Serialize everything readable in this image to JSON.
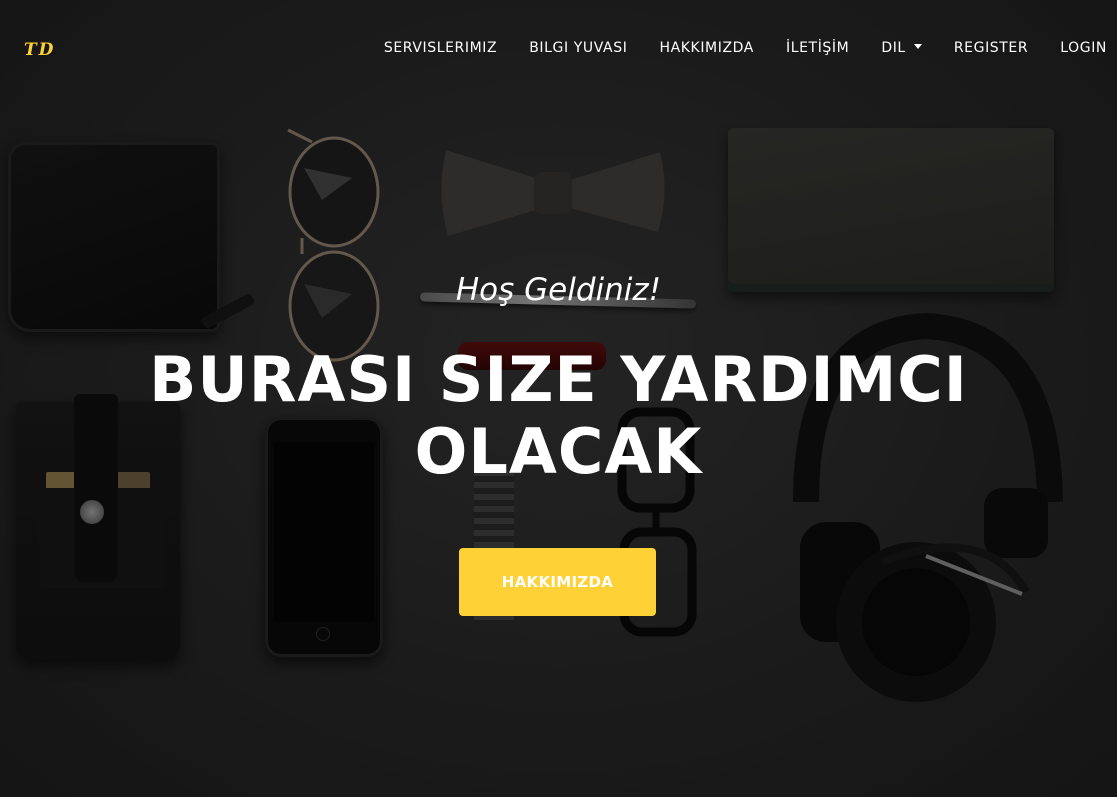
{
  "navbar": {
    "brand": "TD",
    "items": [
      {
        "label": "SERVISLERIMIZ"
      },
      {
        "label": "BILGI YUVASI"
      },
      {
        "label": "HAKKIMIZDA"
      },
      {
        "label": "İLETİŞİM"
      },
      {
        "label": "DIL",
        "has_dropdown": true
      },
      {
        "label": "REGISTER"
      },
      {
        "label": "LOGIN"
      }
    ]
  },
  "hero": {
    "lead_in": "Hoş Geldiniz!",
    "heading": "BURASI SIZE YARDIMCI OLACAK",
    "cta_label": "HAKKIMIZDA"
  },
  "colors": {
    "accent": "#fed136",
    "text": "#ffffff",
    "background": "#2c2c2c"
  },
  "background_image": {
    "objects": [
      "wallet",
      "aviator-sunglasses",
      "bow-tie",
      "notebook",
      "pen",
      "pocket-knife",
      "leather-pouch",
      "smartphone",
      "wristwatch",
      "eyeglasses",
      "headphones"
    ]
  }
}
